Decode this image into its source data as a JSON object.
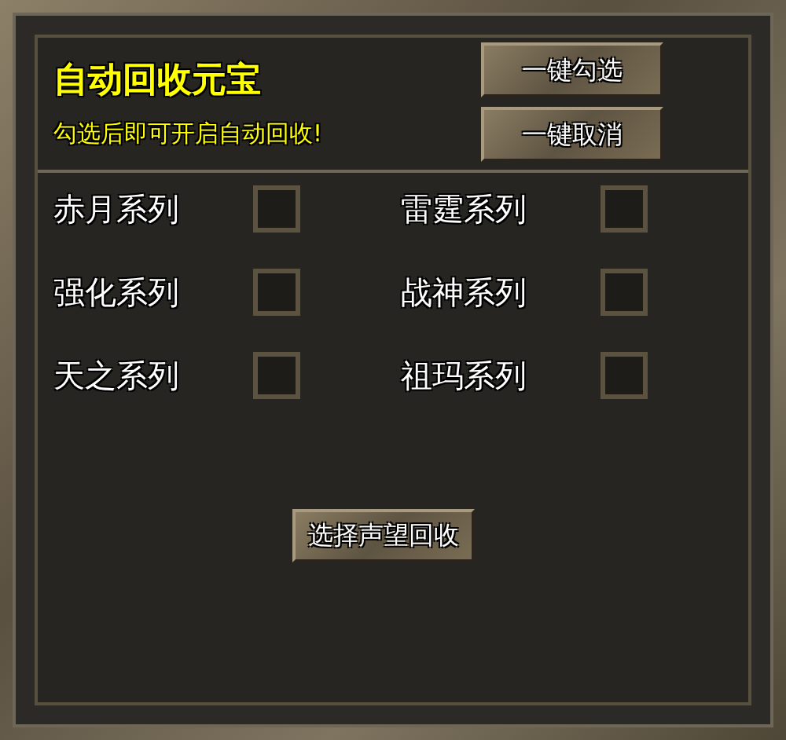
{
  "header": {
    "title": "自动回收元宝",
    "hint": "勾选后即可开启自动回收!"
  },
  "top_buttons": [
    "一键勾选",
    "一键取消"
  ],
  "series": [
    {
      "label": "赤月系列",
      "checked": false
    },
    {
      "label": "雷霆系列",
      "checked": false
    },
    {
      "label": "强化系列",
      "checked": false
    },
    {
      "label": "战神系列",
      "checked": false
    },
    {
      "label": "天之系列",
      "checked": false
    },
    {
      "label": "祖玛系列",
      "checked": false
    }
  ],
  "bottom_button": "选择声望回收"
}
